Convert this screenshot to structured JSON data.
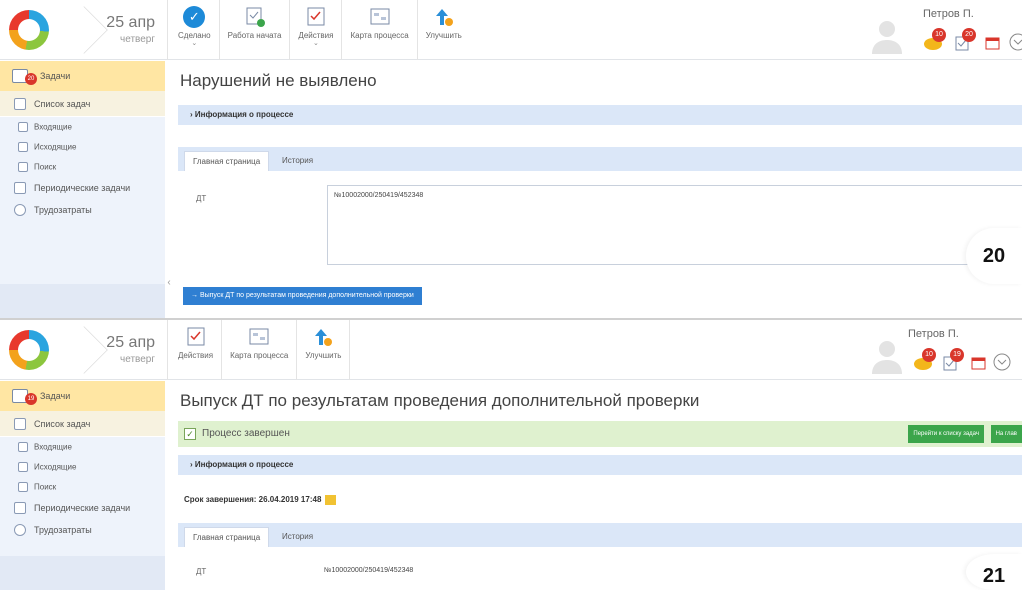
{
  "screen1": {
    "date_day": "25 апр",
    "date_weekday": "четверг",
    "toolbar": [
      {
        "label": "Сделано",
        "icon": "check-circle-icon",
        "has_dropdown": true
      },
      {
        "label": "Работа начата",
        "icon": "task-start-icon",
        "has_dropdown": false
      },
      {
        "label": "Действия",
        "icon": "task-actions-icon",
        "has_dropdown": true
      },
      {
        "label": "Карта процесса",
        "icon": "process-map-icon",
        "has_dropdown": false
      },
      {
        "label": "Улучшить",
        "icon": "improve-arrow-icon",
        "has_dropdown": false
      }
    ],
    "user_name": "Петров П.",
    "notif_badges": [
      "10",
      "20"
    ],
    "sidebar": {
      "tasks_label": "Задачи",
      "tasks_badge": "20",
      "task_list": "Список задач",
      "incoming": "Входящие",
      "outgoing": "Исходящие",
      "search": "Поиск",
      "periodic": "Периодические задачи",
      "labor": "Трудозатраты"
    },
    "title": "Нарушений не выявлено",
    "process_info": "Информация о процессе",
    "tabs": [
      "Главная страница",
      "История"
    ],
    "field_label": "ДТ",
    "field_value": "№10002000/250419/452348",
    "action_button": "→ Выпуск ДТ по результатам проведения дополнительной проверки",
    "slide_number": "20"
  },
  "screen2": {
    "date_day": "25 апр",
    "date_weekday": "четверг",
    "toolbar": [
      {
        "label": "Действия",
        "icon": "task-actions-icon",
        "has_dropdown": false
      },
      {
        "label": "Карта процесса",
        "icon": "process-map-icon",
        "has_dropdown": false
      },
      {
        "label": "Улучшить",
        "icon": "improve-arrow-icon",
        "has_dropdown": false
      }
    ],
    "user_name": "Петров П.",
    "notif_badges": [
      "10",
      "19"
    ],
    "sidebar": {
      "tasks_label": "Задачи",
      "tasks_badge": "19",
      "task_list": "Список задач",
      "incoming": "Входящие",
      "outgoing": "Исходящие",
      "search": "Поиск",
      "periodic": "Периодические задачи",
      "labor": "Трудозатраты"
    },
    "title": "Выпуск ДТ по результатам проведения дополнительной проверки",
    "process_done": "Процесс завершен",
    "btn_goto_list": "Перейти к списку задач",
    "btn_main": "На глав",
    "process_info": "Информация о процессе",
    "deadline": "Срок завершения: 26.04.2019 17:48",
    "tabs": [
      "Главная страница",
      "История"
    ],
    "field_label": "ДТ",
    "field_value": "№10002000/250419/452348",
    "slide_number": "21"
  },
  "colors": {
    "accent_blue": "#2f7fd2",
    "bar_blue": "#dbe7f8",
    "done_green": "#dff1cf",
    "button_green": "#3ba54b",
    "badge_red": "#d9362b",
    "active_sidebar": "#ffe6a3"
  }
}
